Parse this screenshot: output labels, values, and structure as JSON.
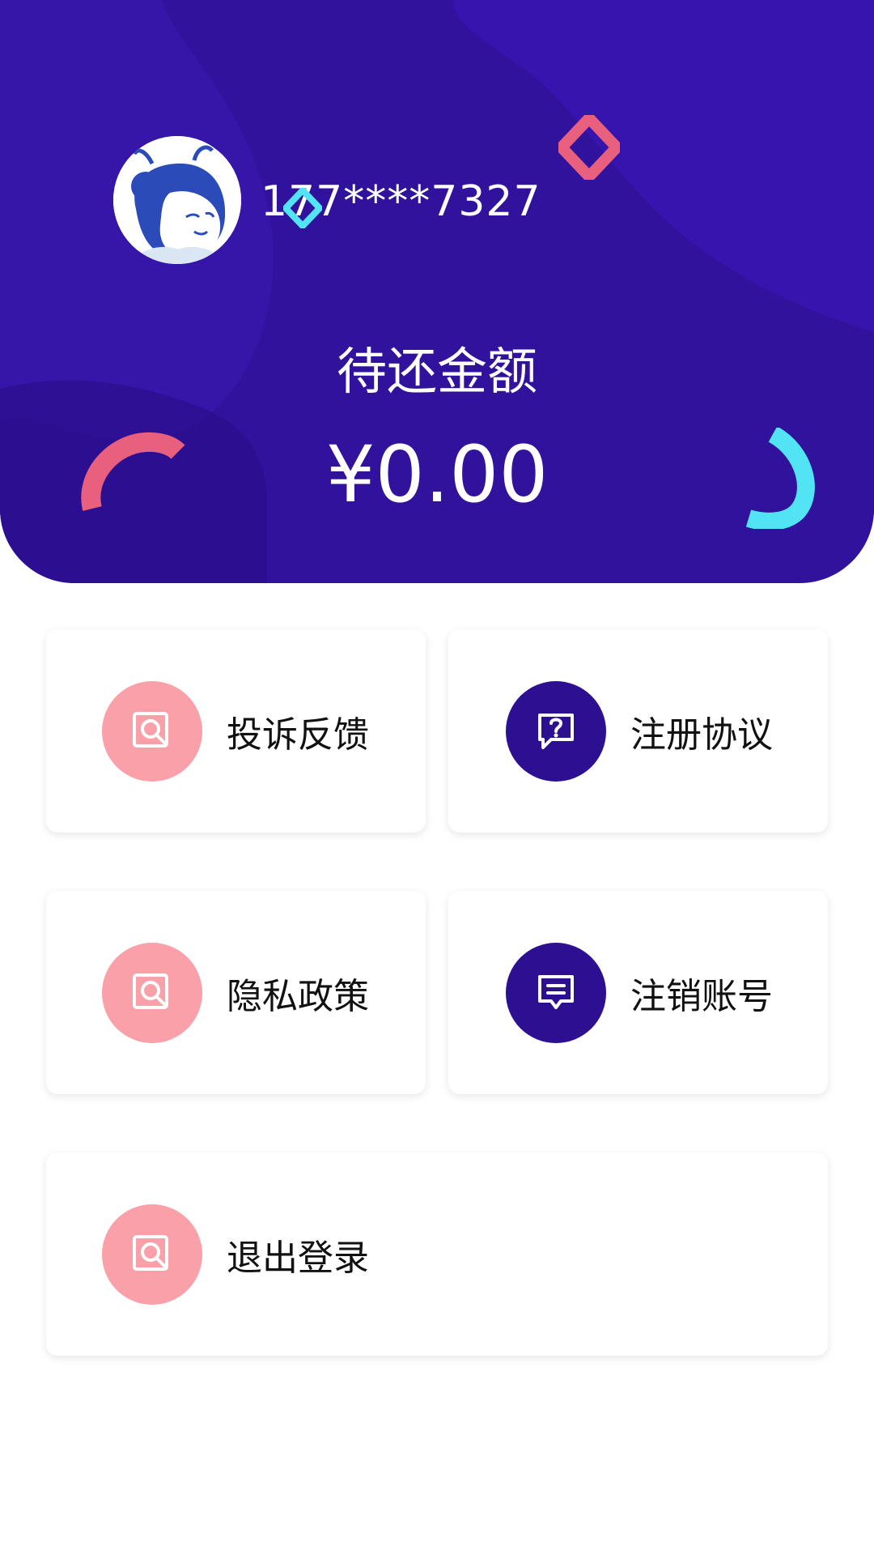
{
  "user": {
    "phone": "177****7327"
  },
  "balance": {
    "label": "待还金额",
    "amount": "¥0.00"
  },
  "menu": [
    {
      "label": "投诉反馈",
      "icon": "search-document-icon",
      "color": "#f9a0a8"
    },
    {
      "label": "注册协议",
      "icon": "question-chat-icon",
      "color": "#2d1091"
    },
    {
      "label": "隐私政策",
      "icon": "search-document-icon",
      "color": "#f9a0a8"
    },
    {
      "label": "注销账号",
      "icon": "message-icon",
      "color": "#2d1091"
    },
    {
      "label": "退出登录",
      "icon": "search-document-icon",
      "color": "#f9a0a8"
    }
  ],
  "colors": {
    "header": "#31129c",
    "accent_pink": "#f9a0a8",
    "accent_purple": "#2d1091",
    "deco_red": "#e8607e",
    "deco_cyan": "#52e4f4"
  }
}
